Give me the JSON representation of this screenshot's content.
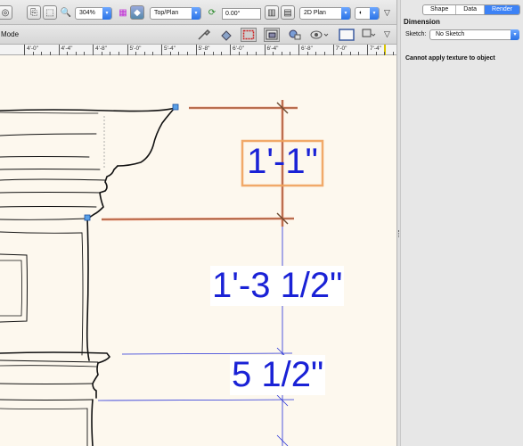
{
  "toolbar": {
    "zoom": "304%",
    "view": "Top/Plan",
    "rotation": "0.00°",
    "render_mode": "2D Plan",
    "mode_label": "Mode"
  },
  "ruler": {
    "labels": [
      "4'-0\"",
      "4'-4\"",
      "4'-8\"",
      "5'-0\"",
      "5'-4\"",
      "5'-8\"",
      "6'-0\"",
      "6'-4\"",
      "6'-8\"",
      "7'-0\"",
      "7'-4\""
    ]
  },
  "panel": {
    "tabs": [
      {
        "label": "Shape",
        "active": false
      },
      {
        "label": "Data",
        "active": false
      },
      {
        "label": "Render",
        "active": true
      }
    ],
    "title": "Dimension",
    "sketch_label": "Sketch:",
    "sketch_value": "No Sketch",
    "message": "Cannot apply texture to object"
  },
  "dimensions": [
    {
      "text": "1'-1\"",
      "selected": true
    },
    {
      "text": "1'-3 1/2\"",
      "selected": false
    },
    {
      "text": "5 1/2\"",
      "selected": false
    }
  ],
  "colors": {
    "dimension_text": "#1a22d6",
    "selection_highlight": "#f0a05a",
    "accent": "#3c82f6"
  }
}
